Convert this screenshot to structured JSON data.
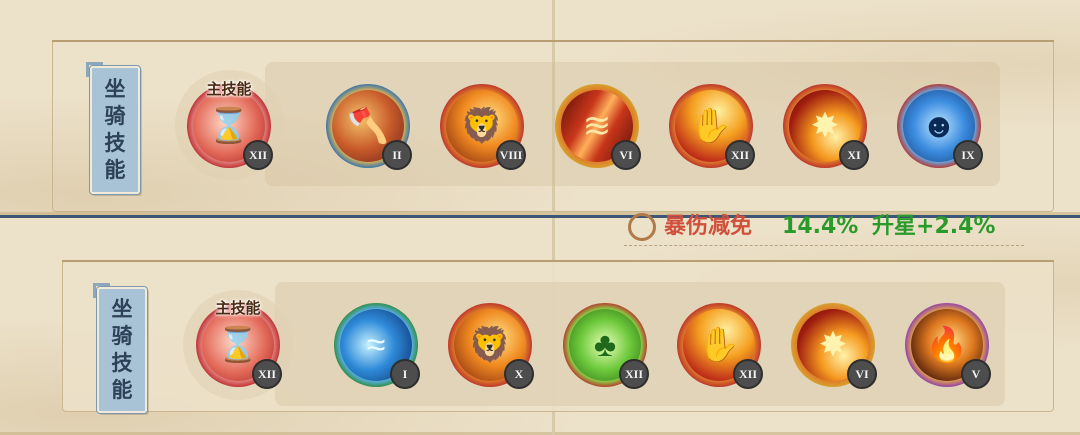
{
  "panel_label": [
    "坐",
    "骑",
    "技",
    "能"
  ],
  "main_skill_label": "主技能",
  "stat_row": {
    "name": "暴伤减免",
    "value": "14.4%",
    "bonus": "升星+2.4%"
  },
  "rows": [
    {
      "main": {
        "level": "XII",
        "theme": "red"
      },
      "skills": [
        {
          "level": "II",
          "theme": "bear-axe",
          "ring": "#2a6fb0"
        },
        {
          "level": "VIII",
          "theme": "lion",
          "ring": "#b8312a"
        },
        {
          "level": "VI",
          "theme": "claw",
          "ring": "#d6a62e"
        },
        {
          "level": "XII",
          "theme": "fire-claw",
          "ring": "#b8312a"
        },
        {
          "level": "XI",
          "theme": "blaze",
          "ring": "#b8312a"
        },
        {
          "level": "IX",
          "theme": "spirit",
          "ring": "#b8312a"
        }
      ]
    },
    {
      "main": {
        "level": "XII",
        "theme": "red"
      },
      "skills": [
        {
          "level": "I",
          "theme": "water",
          "ring": "#2d8b3a"
        },
        {
          "level": "X",
          "theme": "lion",
          "ring": "#b8312a"
        },
        {
          "level": "XII",
          "theme": "clover",
          "ring": "#b8312a"
        },
        {
          "level": "XII",
          "theme": "fire-claw",
          "ring": "#b8312a"
        },
        {
          "level": "VI",
          "theme": "blaze",
          "ring": "#d6a62e"
        },
        {
          "level": "V",
          "theme": "dark-fire",
          "ring": "#8b3ab0"
        }
      ]
    }
  ]
}
